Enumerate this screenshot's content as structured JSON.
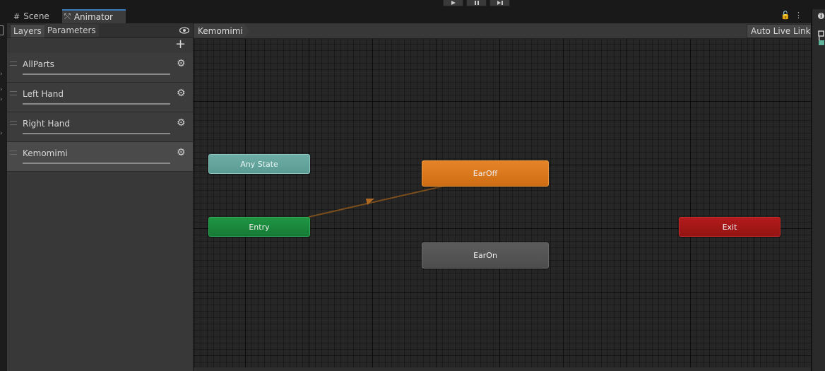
{
  "tabs": {
    "scene": "Scene",
    "animator": "Animator"
  },
  "layers_panel": {
    "tab_layers": "Layers",
    "tab_parameters": "Parameters",
    "add_icon": "plus-icon",
    "layers": [
      {
        "name": "AllParts"
      },
      {
        "name": "Left Hand"
      },
      {
        "name": "Right Hand"
      },
      {
        "name": "Kemomimi",
        "selected": true
      }
    ]
  },
  "graph": {
    "breadcrumb": "Kemomimi",
    "auto_live_link": "Auto Live Link",
    "nodes": {
      "any_state": "Any State",
      "entry": "Entry",
      "exit": "Exit",
      "ear_off": "EarOff",
      "ear_on": "EarOn"
    },
    "colors": {
      "any_state": "#62a49c",
      "entry": "#1a8a3c",
      "exit": "#a31717",
      "default_state": "#dc781e",
      "state": "#545454",
      "transition": "#7a4d1c"
    }
  }
}
